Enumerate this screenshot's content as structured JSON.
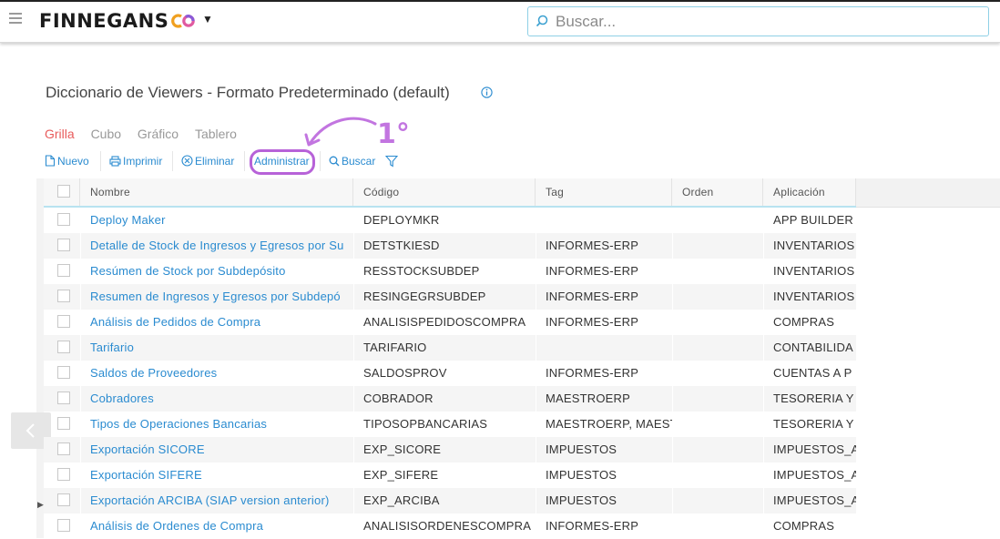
{
  "header": {
    "brand": "FINNEGANS",
    "search_placeholder": "Buscar..."
  },
  "page": {
    "title": "Diccionario de Viewers - Formato Predeterminado (default)"
  },
  "tabs": [
    {
      "label": "Grilla",
      "active": true
    },
    {
      "label": "Cubo",
      "active": false
    },
    {
      "label": "Gráfico",
      "active": false
    },
    {
      "label": "Tablero",
      "active": false
    }
  ],
  "toolbar": {
    "nuevo": "Nuevo",
    "imprimir": "Imprimir",
    "eliminar": "Eliminar",
    "administrar": "Administrar",
    "buscar": "Buscar"
  },
  "annotation": {
    "text": "1°",
    "color": "#b762d8"
  },
  "grid": {
    "columns": [
      "Nombre",
      "Código",
      "Tag",
      "Orden",
      "Aplicación"
    ],
    "rows": [
      {
        "nombre": "Deploy Maker",
        "codigo": "DEPLOYMKR",
        "tag": "",
        "orden": "",
        "aplicacion": "APP BUILDER"
      },
      {
        "nombre": "Detalle de Stock de Ingresos y Egresos por Su",
        "codigo": "DETSTKIESD",
        "tag": "INFORMES-ERP",
        "orden": "",
        "aplicacion": "INVENTARIOS"
      },
      {
        "nombre": "Resúmen de Stock por Subdepósito",
        "codigo": "RESSTOCKSUBDEP",
        "tag": "INFORMES-ERP",
        "orden": "",
        "aplicacion": "INVENTARIOS"
      },
      {
        "nombre": "Resumen de Ingresos y Egresos por Subdepó",
        "codigo": "RESINGEGRSUBDEP",
        "tag": "INFORMES-ERP",
        "orden": "",
        "aplicacion": "INVENTARIOS"
      },
      {
        "nombre": "Análisis de Pedidos de Compra",
        "codigo": "ANALISISPEDIDOSCOMPRA",
        "tag": "INFORMES-ERP",
        "orden": "",
        "aplicacion": "COMPRAS"
      },
      {
        "nombre": "Tarifario",
        "codigo": "TARIFARIO",
        "tag": "",
        "orden": "",
        "aplicacion": "CONTABILIDA"
      },
      {
        "nombre": "Saldos de Proveedores",
        "codigo": "SALDOSPROV",
        "tag": "INFORMES-ERP",
        "orden": "",
        "aplicacion": "CUENTAS A P"
      },
      {
        "nombre": "Cobradores",
        "codigo": "COBRADOR",
        "tag": "MAESTROERP",
        "orden": "",
        "aplicacion": "TESORERIA Y"
      },
      {
        "nombre": "Tipos de Operaciones Bancarias",
        "codigo": "TIPOSOPBANCARIAS",
        "tag": "MAESTROERP, MAEST",
        "orden": "",
        "aplicacion": "TESORERIA Y"
      },
      {
        "nombre": "Exportación SICORE",
        "codigo": "EXP_SICORE",
        "tag": "IMPUESTOS",
        "orden": "",
        "aplicacion": "IMPUESTOS_A"
      },
      {
        "nombre": "Exportación SIFERE",
        "codigo": "EXP_SIFERE",
        "tag": "IMPUESTOS",
        "orden": "",
        "aplicacion": "IMPUESTOS_A"
      },
      {
        "nombre": "Exportación ARCIBA (SIAP version anterior)",
        "codigo": "EXP_ARCIBA",
        "tag": "IMPUESTOS",
        "orden": "",
        "aplicacion": "IMPUESTOS_A"
      },
      {
        "nombre": "Análisis de Ordenes de Compra",
        "codigo": "ANALISISORDENESCOMPRA",
        "tag": "INFORMES-ERP",
        "orden": "",
        "aplicacion": "COMPRAS"
      }
    ]
  }
}
